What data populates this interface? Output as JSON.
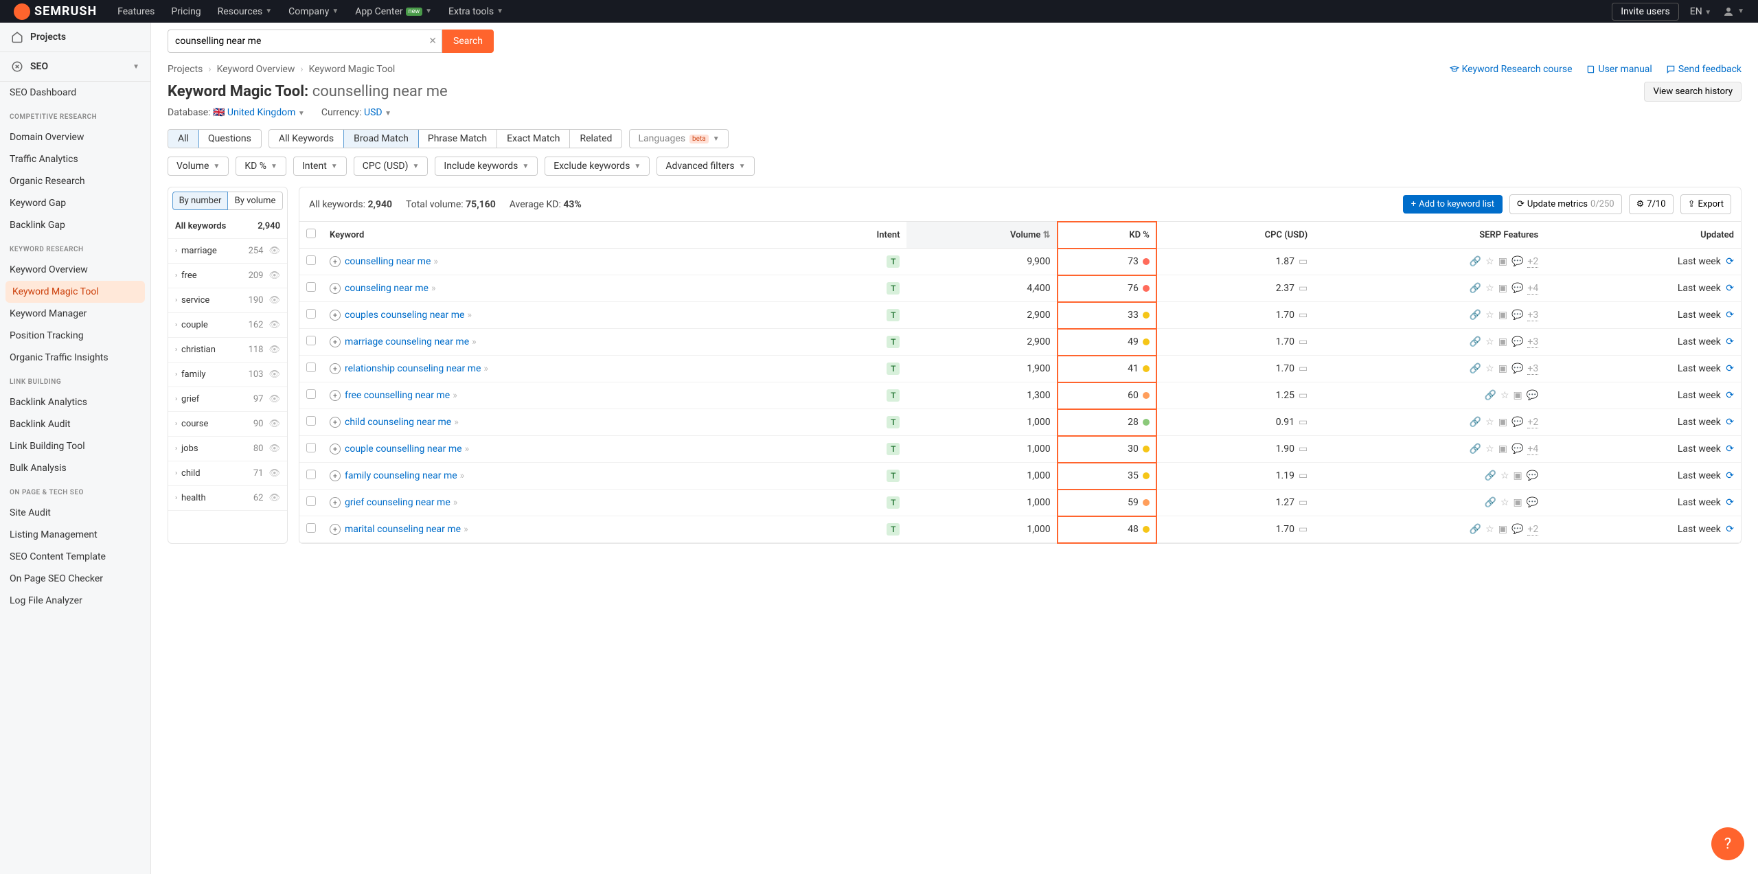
{
  "topbar": {
    "logo": "SEMRUSH",
    "nav": [
      "Features",
      "Pricing",
      "Resources",
      "Company",
      "App Center",
      "Extra tools"
    ],
    "new_badge": "new",
    "invite": "Invite users",
    "lang": "EN"
  },
  "sidebar": {
    "projects": "Projects",
    "seo": "SEO",
    "dashboard": "SEO Dashboard",
    "groups": [
      {
        "label": "COMPETITIVE RESEARCH",
        "items": [
          "Domain Overview",
          "Traffic Analytics",
          "Organic Research",
          "Keyword Gap",
          "Backlink Gap"
        ]
      },
      {
        "label": "KEYWORD RESEARCH",
        "items": [
          "Keyword Overview",
          "Keyword Magic Tool",
          "Keyword Manager",
          "Position Tracking",
          "Organic Traffic Insights"
        ]
      },
      {
        "label": "LINK BUILDING",
        "items": [
          "Backlink Analytics",
          "Backlink Audit",
          "Link Building Tool",
          "Bulk Analysis"
        ]
      },
      {
        "label": "ON PAGE & TECH SEO",
        "items": [
          "Site Audit",
          "Listing Management",
          "SEO Content Template",
          "On Page SEO Checker",
          "Log File Analyzer"
        ]
      }
    ]
  },
  "search": {
    "value": "counselling near me",
    "button": "Search"
  },
  "breadcrumbs": [
    "Projects",
    "Keyword Overview",
    "Keyword Magic Tool"
  ],
  "header_links": {
    "course": "Keyword Research course",
    "manual": "User manual",
    "feedback": "Send feedback"
  },
  "page": {
    "title_prefix": "Keyword Magic Tool:",
    "query": "counselling near me",
    "history_btn": "View search history",
    "db_label": "Database:",
    "db_value": "United Kingdom",
    "currency_label": "Currency:",
    "currency_value": "USD"
  },
  "tabs": {
    "group1": [
      "All",
      "Questions"
    ],
    "group2": [
      "All Keywords",
      "Broad Match",
      "Phrase Match",
      "Exact Match",
      "Related"
    ],
    "languages": "Languages",
    "beta": "beta"
  },
  "filters": [
    "Volume",
    "KD %",
    "Intent",
    "CPC (USD)",
    "Include keywords",
    "Exclude keywords",
    "Advanced filters"
  ],
  "panel": {
    "by_number": "By number",
    "by_volume": "By volume",
    "all_kw": "All keywords",
    "all_count": "2,940",
    "rows": [
      {
        "kw": "marriage",
        "n": "254"
      },
      {
        "kw": "free",
        "n": "209"
      },
      {
        "kw": "service",
        "n": "190"
      },
      {
        "kw": "couple",
        "n": "162"
      },
      {
        "kw": "christian",
        "n": "118"
      },
      {
        "kw": "family",
        "n": "103"
      },
      {
        "kw": "grief",
        "n": "97"
      },
      {
        "kw": "course",
        "n": "90"
      },
      {
        "kw": "jobs",
        "n": "80"
      },
      {
        "kw": "child",
        "n": "71"
      },
      {
        "kw": "health",
        "n": "62"
      }
    ]
  },
  "toolbar": {
    "all_kw_label": "All keywords:",
    "all_kw": "2,940",
    "total_vol_label": "Total volume:",
    "total_vol": "75,160",
    "avg_kd_label": "Average KD:",
    "avg_kd": "43%",
    "add_btn": "Add to keyword list",
    "update_btn": "Update metrics",
    "update_count": "0/250",
    "gear_count": "7/10",
    "export_btn": "Export"
  },
  "columns": [
    "Keyword",
    "Intent",
    "Volume",
    "KD %",
    "CPC (USD)",
    "SERP Features",
    "Updated"
  ],
  "rows": [
    {
      "kw": "counselling near me",
      "intent": "T",
      "vol": "9,900",
      "kd": "73",
      "kd_color": "#ff6b5b",
      "cpc": "1.87",
      "serp_more": "+2",
      "updated": "Last week"
    },
    {
      "kw": "counseling near me",
      "intent": "T",
      "vol": "4,400",
      "kd": "76",
      "kd_color": "#ff6b5b",
      "cpc": "2.37",
      "serp_more": "+4",
      "updated": "Last week"
    },
    {
      "kw": "couples counseling near me",
      "intent": "T",
      "vol": "2,900",
      "kd": "33",
      "kd_color": "#f5c518",
      "cpc": "1.70",
      "serp_more": "+3",
      "updated": "Last week"
    },
    {
      "kw": "marriage counseling near me",
      "intent": "T",
      "vol": "2,900",
      "kd": "49",
      "kd_color": "#f5c518",
      "cpc": "1.70",
      "serp_more": "+3",
      "updated": "Last week"
    },
    {
      "kw": "relationship counseling near me",
      "intent": "T",
      "vol": "1,900",
      "kd": "41",
      "kd_color": "#f5c518",
      "cpc": "1.70",
      "serp_more": "+3",
      "updated": "Last week"
    },
    {
      "kw": "free counselling near me",
      "intent": "T",
      "vol": "1,300",
      "kd": "60",
      "kd_color": "#ff9e5b",
      "cpc": "1.25",
      "serp_more": "",
      "updated": "Last week"
    },
    {
      "kw": "child counseling near me",
      "intent": "T",
      "vol": "1,000",
      "kd": "28",
      "kd_color": "#8bc97a",
      "cpc": "0.91",
      "serp_more": "+2",
      "updated": "Last week"
    },
    {
      "kw": "couple counselling near me",
      "intent": "T",
      "vol": "1,000",
      "kd": "30",
      "kd_color": "#f5c518",
      "cpc": "1.90",
      "serp_more": "+4",
      "updated": "Last week"
    },
    {
      "kw": "family counseling near me",
      "intent": "T",
      "vol": "1,000",
      "kd": "35",
      "kd_color": "#f5c518",
      "cpc": "1.19",
      "serp_more": "",
      "updated": "Last week"
    },
    {
      "kw": "grief counseling near me",
      "intent": "T",
      "vol": "1,000",
      "kd": "59",
      "kd_color": "#ff9e5b",
      "cpc": "1.27",
      "serp_more": "",
      "updated": "Last week"
    },
    {
      "kw": "marital counseling near me",
      "intent": "T",
      "vol": "1,000",
      "kd": "48",
      "kd_color": "#f5c518",
      "cpc": "1.70",
      "serp_more": "+2",
      "updated": "Last week"
    }
  ]
}
